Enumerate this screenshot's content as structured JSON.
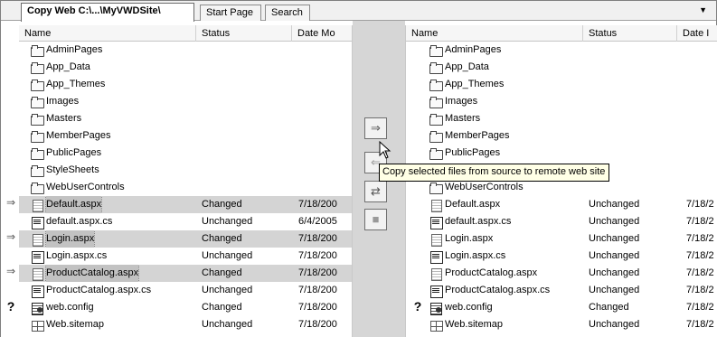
{
  "tabs": [
    {
      "label": "Copy Web C:\\...\\MyVWDSite\\",
      "active": true
    },
    {
      "label": "Start Page",
      "active": false
    },
    {
      "label": "Search",
      "active": false
    }
  ],
  "tab_menu_icon": "chevron-down-icon",
  "left_pane": {
    "columns": [
      "Name",
      "Status",
      "Date Mo"
    ],
    "rows": [
      {
        "name": "AdminPages",
        "icon": "folder-icon",
        "status": "",
        "date": "",
        "marker": "",
        "selected": false
      },
      {
        "name": "App_Data",
        "icon": "folder-icon",
        "status": "",
        "date": "",
        "marker": "",
        "selected": false
      },
      {
        "name": "App_Themes",
        "icon": "folder-icon",
        "status": "",
        "date": "",
        "marker": "",
        "selected": false
      },
      {
        "name": "Images",
        "icon": "folder-icon",
        "status": "",
        "date": "",
        "marker": "",
        "selected": false
      },
      {
        "name": "Masters",
        "icon": "folder-icon",
        "status": "",
        "date": "",
        "marker": "",
        "selected": false
      },
      {
        "name": "MemberPages",
        "icon": "folder-icon",
        "status": "",
        "date": "",
        "marker": "",
        "selected": false
      },
      {
        "name": "PublicPages",
        "icon": "folder-icon",
        "status": "",
        "date": "",
        "marker": "",
        "selected": false
      },
      {
        "name": "StyleSheets",
        "icon": "folder-icon",
        "status": "",
        "date": "",
        "marker": "",
        "selected": false
      },
      {
        "name": "WebUserControls",
        "icon": "folder-icon",
        "status": "",
        "date": "",
        "marker": "",
        "selected": false
      },
      {
        "name": "Default.aspx",
        "icon": "aspx-icon",
        "status": "Changed",
        "date": "7/18/200",
        "marker": "⇒",
        "selected": true
      },
      {
        "name": "default.aspx.cs",
        "icon": "code-icon",
        "status": "Unchanged",
        "date": "6/4/2005",
        "marker": "",
        "selected": false
      },
      {
        "name": "Login.aspx",
        "icon": "aspx-icon",
        "status": "Changed",
        "date": "7/18/200",
        "marker": "⇒",
        "selected": true
      },
      {
        "name": "Login.aspx.cs",
        "icon": "code-icon",
        "status": "Unchanged",
        "date": "7/18/200",
        "marker": "",
        "selected": false
      },
      {
        "name": "ProductCatalog.aspx",
        "icon": "aspx-icon",
        "status": "Changed",
        "date": "7/18/200",
        "marker": "⇒",
        "selected": true
      },
      {
        "name": "ProductCatalog.aspx.cs",
        "icon": "code-icon",
        "status": "Unchanged",
        "date": "7/18/200",
        "marker": "",
        "selected": false
      },
      {
        "name": "web.config",
        "icon": "config-icon",
        "status": "Changed",
        "date": "7/18/200",
        "marker": "?",
        "selected": false
      },
      {
        "name": "Web.sitemap",
        "icon": "sitemap-icon",
        "status": "Unchanged",
        "date": "7/18/200",
        "marker": "",
        "selected": false
      }
    ]
  },
  "right_pane": {
    "columns": [
      "Name",
      "Status",
      "Date I"
    ],
    "rows": [
      {
        "name": "AdminPages",
        "icon": "folder-icon",
        "status": "",
        "date": "",
        "marker": ""
      },
      {
        "name": "App_Data",
        "icon": "folder-icon",
        "status": "",
        "date": "",
        "marker": ""
      },
      {
        "name": "App_Themes",
        "icon": "folder-icon",
        "status": "",
        "date": "",
        "marker": ""
      },
      {
        "name": "Images",
        "icon": "folder-icon",
        "status": "",
        "date": "",
        "marker": ""
      },
      {
        "name": "Masters",
        "icon": "folder-icon",
        "status": "",
        "date": "",
        "marker": ""
      },
      {
        "name": "MemberPages",
        "icon": "folder-icon",
        "status": "",
        "date": "",
        "marker": ""
      },
      {
        "name": "PublicPages",
        "icon": "folder-icon",
        "status": "",
        "date": "",
        "marker": ""
      },
      {
        "name": "",
        "icon": "",
        "status": "",
        "date": "",
        "marker": ""
      },
      {
        "name": "WebUserControls",
        "icon": "folder-icon",
        "status": "",
        "date": "",
        "marker": ""
      },
      {
        "name": "Default.aspx",
        "icon": "aspx-icon",
        "status": "Unchanged",
        "date": "7/18/2",
        "marker": ""
      },
      {
        "name": "default.aspx.cs",
        "icon": "code-icon",
        "status": "Unchanged",
        "date": "7/18/2",
        "marker": ""
      },
      {
        "name": "Login.aspx",
        "icon": "aspx-icon",
        "status": "Unchanged",
        "date": "7/18/2",
        "marker": ""
      },
      {
        "name": "Login.aspx.cs",
        "icon": "code-icon",
        "status": "Unchanged",
        "date": "7/18/2",
        "marker": ""
      },
      {
        "name": "ProductCatalog.aspx",
        "icon": "aspx-icon",
        "status": "Unchanged",
        "date": "7/18/2",
        "marker": ""
      },
      {
        "name": "ProductCatalog.aspx.cs",
        "icon": "code-icon",
        "status": "Unchanged",
        "date": "7/18/2",
        "marker": ""
      },
      {
        "name": "web.config",
        "icon": "config-icon",
        "status": "Changed",
        "date": "7/18/2",
        "marker": "?"
      },
      {
        "name": "Web.sitemap",
        "icon": "sitemap-icon",
        "status": "Unchanged",
        "date": "7/18/2",
        "marker": ""
      }
    ]
  },
  "middle_buttons": [
    {
      "name": "copy-to-remote-button",
      "glyph": "⇒",
      "enabled": true
    },
    {
      "name": "copy-to-local-button",
      "glyph": "⇐",
      "enabled": false
    },
    {
      "name": "synchronize-button",
      "glyph": "⇄",
      "enabled": true
    },
    {
      "name": "stop-button",
      "glyph": "■",
      "enabled": false
    }
  ],
  "tooltip": "Copy selected files from source to remote web site",
  "colors": {
    "selection": "#d4d4d4",
    "divider": "#d6d6d6",
    "tooltip_bg": "#ffffe6"
  }
}
